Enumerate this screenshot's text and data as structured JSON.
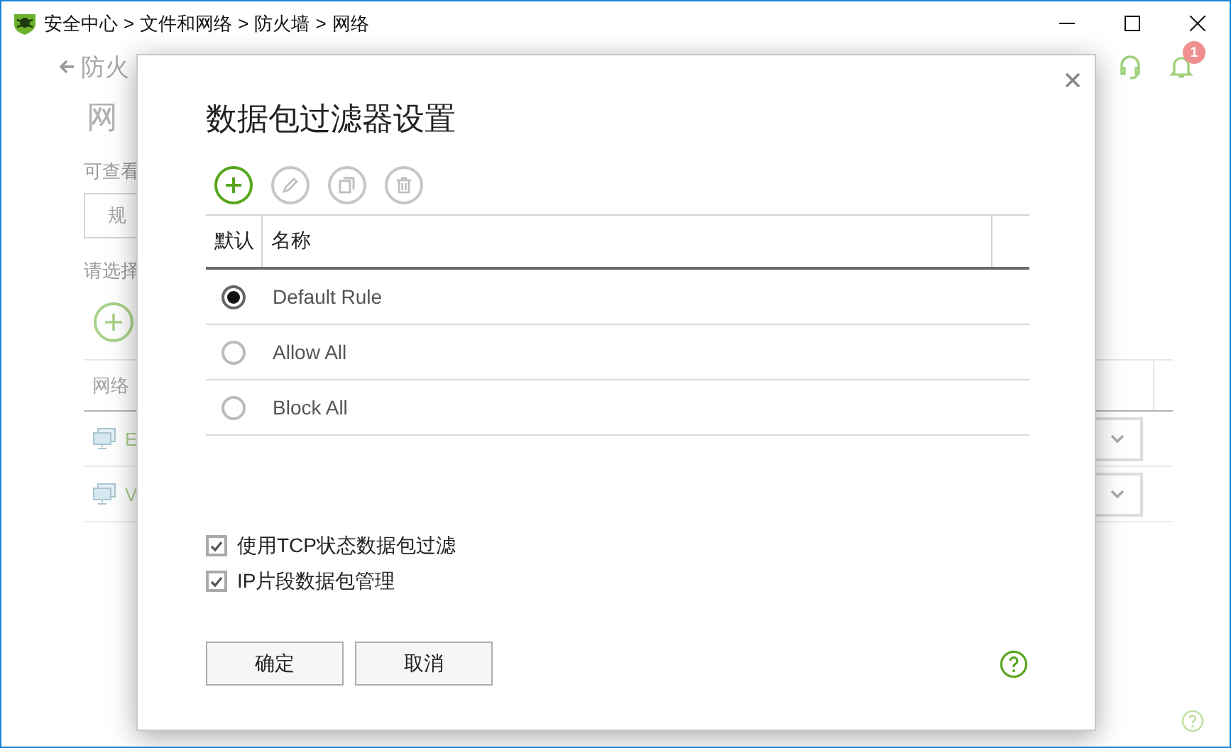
{
  "window": {
    "breadcrumb": [
      {
        "kind": "crumb",
        "label": "安全中心"
      },
      {
        "kind": "separator",
        "label": ">"
      },
      {
        "kind": "crumb",
        "label": "文件和网络"
      },
      {
        "kind": "separator",
        "label": ">"
      },
      {
        "kind": "crumb",
        "label": "防火墙"
      },
      {
        "kind": "separator",
        "label": ">"
      },
      {
        "kind": "crumb",
        "label": "网络"
      }
    ]
  },
  "background": {
    "back_link": "防火",
    "page_title": "网",
    "view_label": "可查看",
    "view_select": "规",
    "choose_label": "请选择",
    "table_header": "网络",
    "notification_count": "1",
    "rows": [
      {
        "label": "E"
      },
      {
        "label": "V"
      }
    ]
  },
  "dialog": {
    "title": "数据包过滤器设置",
    "toolbar": [
      {
        "kind": "add",
        "disabled": false
      },
      {
        "kind": "edit",
        "disabled": true
      },
      {
        "kind": "copy",
        "disabled": true
      },
      {
        "kind": "delete",
        "disabled": true
      }
    ],
    "columns": [
      "默认",
      "名称"
    ],
    "rules": [
      {
        "name": "Default Rule",
        "selected": true
      },
      {
        "name": "Allow All",
        "selected": false
      },
      {
        "name": "Block All",
        "selected": false
      }
    ],
    "options": [
      {
        "label": "使用TCP状态数据包过滤",
        "checked": true
      },
      {
        "label": "IP片段数据包管理",
        "checked": true
      }
    ],
    "buttons": [
      "确定",
      "取消"
    ]
  }
}
